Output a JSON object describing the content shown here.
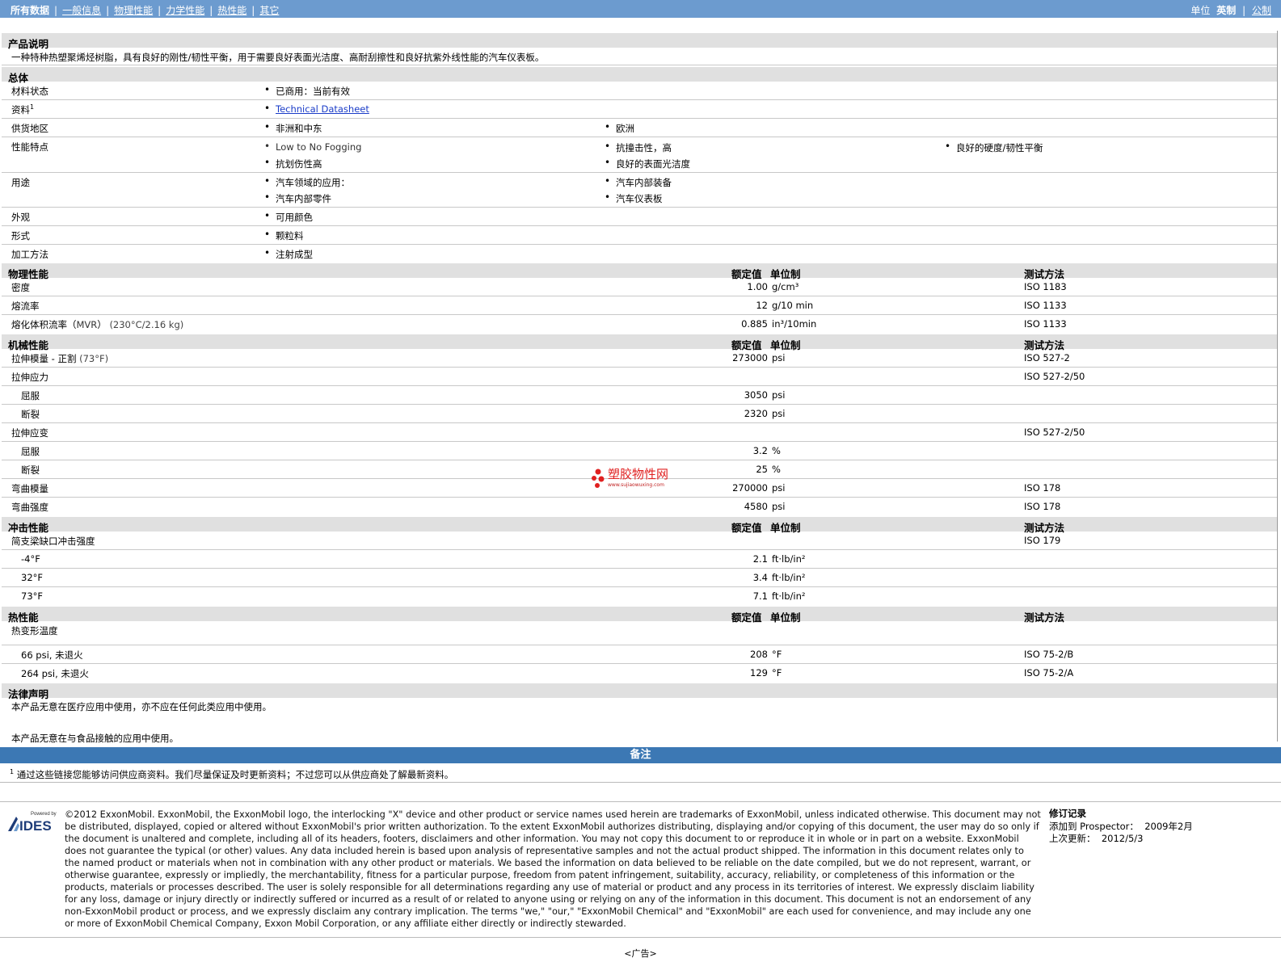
{
  "nav": {
    "items": [
      "所有数据",
      "一般信息",
      "物理性能",
      "力学性能",
      "热性能",
      "其它"
    ],
    "units_label": "单位",
    "unit_english": "英制",
    "unit_metric": "公制"
  },
  "product_desc": {
    "title": "产品说明",
    "text": "一种特种热塑聚烯烃树脂，具有良好的刚性/韧性平衡，用于需要良好表面光洁度、高耐刮擦性和良好抗紫外线性能的汽车仪表板。"
  },
  "general": {
    "title": "总体",
    "rows": [
      {
        "label": "材料状态",
        "items": [
          "已商用：当前有效"
        ]
      },
      {
        "label": "资料",
        "sup": "1",
        "items": [
          "Technical Datasheet"
        ]
      },
      {
        "label": "供货地区",
        "items": [
          "非洲和中东",
          "欧洲"
        ]
      },
      {
        "label": "性能特点",
        "items": [
          "Low to No Fogging",
          "抗撞击性，高",
          "良好的硬度/韧性平衡",
          "抗划伤性高",
          "良好的表面光洁度"
        ]
      },
      {
        "label": "用途",
        "items": [
          "汽车领域的应用：",
          "汽车内部装备",
          "汽车内部零件",
          "汽车仪表板"
        ]
      },
      {
        "label": "外观",
        "items": [
          "可用颜色"
        ]
      },
      {
        "label": "形式",
        "items": [
          "颗粒料"
        ]
      },
      {
        "label": "加工方法",
        "items": [
          "注射成型"
        ]
      }
    ]
  },
  "col_headers": {
    "value": "额定值",
    "unit": "单位制",
    "test": "测试方法"
  },
  "physical": {
    "title": "物理性能",
    "rows": [
      {
        "label": "密度",
        "value": "1.00",
        "unit": "g/cm³",
        "test": "ISO 1183"
      },
      {
        "label": "熔流率",
        "value": "12",
        "unit": "g/10 min",
        "test": "ISO 1133"
      },
      {
        "label": "熔化体积流率（",
        "label2": "MVR",
        "label3": "）",
        "cond": "(230°C/2.16 kg)",
        "value": "0.885",
        "unit": "in³/10min",
        "test": "ISO 1133"
      }
    ]
  },
  "mechanical": {
    "title": "机械性能",
    "rows": [
      {
        "label": "拉伸模量",
        "label2": "- 正割",
        "cond": "(73°F)",
        "value": "273000",
        "unit": "psi",
        "test": "ISO 527-2"
      },
      {
        "label": "拉伸应力",
        "value": "",
        "unit": "",
        "test": "ISO 527-2/50"
      },
      {
        "label": "屈服",
        "value": "3050",
        "unit": "psi",
        "test": ""
      },
      {
        "label": "断裂",
        "value": "2320",
        "unit": "psi",
        "test": ""
      },
      {
        "label": "拉伸应变",
        "value": "",
        "unit": "",
        "test": "ISO 527-2/50"
      },
      {
        "label": "屈服",
        "value": "3.2",
        "unit": "%",
        "test": ""
      },
      {
        "label": "断裂",
        "value": "25",
        "unit": "%",
        "test": ""
      },
      {
        "label": "弯曲模量",
        "value": "270000",
        "unit": "psi",
        "test": "ISO 178"
      },
      {
        "label": "弯曲强度",
        "value": "4580",
        "unit": "psi",
        "test": "ISO 178"
      }
    ]
  },
  "impact": {
    "title": "冲击性能",
    "rows": [
      {
        "label": "简支梁缺口冲击强度",
        "value": "",
        "unit": "",
        "test": "ISO 179"
      },
      {
        "label": "-4°F",
        "value": "2.1",
        "unit": "ft·lb/in²",
        "test": ""
      },
      {
        "label": "32°F",
        "value": "3.4",
        "unit": "ft·lb/in²",
        "test": ""
      },
      {
        "label": "73°F",
        "value": "7.1",
        "unit": "ft·lb/in²",
        "test": ""
      }
    ]
  },
  "thermal": {
    "title": "热性能",
    "rows": [
      {
        "label": "热变形温度",
        "value": "",
        "unit": "",
        "test": ""
      },
      {
        "label": "66 psi, 未退火",
        "value": "208",
        "unit": "°F",
        "test": "ISO 75-2/B"
      },
      {
        "label": "264 psi, 未退火",
        "value": "129",
        "unit": "°F",
        "test": "ISO 75-2/A"
      }
    ]
  },
  "legal": {
    "title": "法律声明",
    "line1": "本产品无意在医疗应用中使用，亦不应在任何此类应用中使用。",
    "line2": "本产品无意在与食品接触的应用中使用。"
  },
  "notes": {
    "title": "备注",
    "sup": "1",
    "text": "通过这些链接您能够访问供应商资料。我们尽量保证及时更新资料；不过您可以从供应商处了解最新资料。"
  },
  "footer": {
    "powered_by": "Powered by",
    "logo": "IDES",
    "copyright": "©2012 ExxonMobil. ExxonMobil, the ExxonMobil logo, the interlocking \"X\" device and other product or service names used herein are trademarks of ExxonMobil, unless indicated otherwise. This document may not be distributed, displayed, copied or altered without ExxonMobil's prior written authorization. To the extent ExxonMobil authorizes distributing, displaying and/or copying of this document, the user may do so only if the document is unaltered and complete, including all of its headers, footers, disclaimers and other information. You may not copy this document to or reproduce it in whole or in part on a website. ExxonMobil does not guarantee the typical (or other) values. Any data included herein is based upon analysis of representative samples and not the actual product shipped. The information in this document relates only to the named product or materials when not in combination with any other product or materials. We based the information on data believed to be reliable on the date compiled, but we do not represent, warrant, or otherwise guarantee, expressly or impliedly, the merchantability, fitness for a particular purpose, freedom from patent infringement, suitability, accuracy, reliability, or completeness of this information or the products, materials or processes described. The user is solely responsible for all determinations regarding any use of material or product and any process in its territories of interest. We expressly disclaim liability for any loss, damage or injury directly or indirectly suffered or incurred as a result of or related to anyone using or relying on any of the information in this document. This document is not an endorsement of any non-ExxonMobil product or process, and we expressly disclaim any contrary implication. The terms \"we,\" \"our,\" \"ExxonMobil Chemical\" and \"ExxonMobil\" are each used for convenience, and may include any one or more of ExxonMobil Chemical Company, Exxon Mobil Corporation, or any affiliate either directly or indirectly stewarded.",
    "revision_title": "修订记录",
    "added_label": "添加到",
    "added_source": "Prospector：",
    "added_date": "2009年2月",
    "updated_label": "上次更新：",
    "updated_date": "2012/5/3",
    "ad": "<广告>"
  },
  "watermark": {
    "title": "塑胶物性网",
    "url": "www.sujiaowuxing.com"
  }
}
